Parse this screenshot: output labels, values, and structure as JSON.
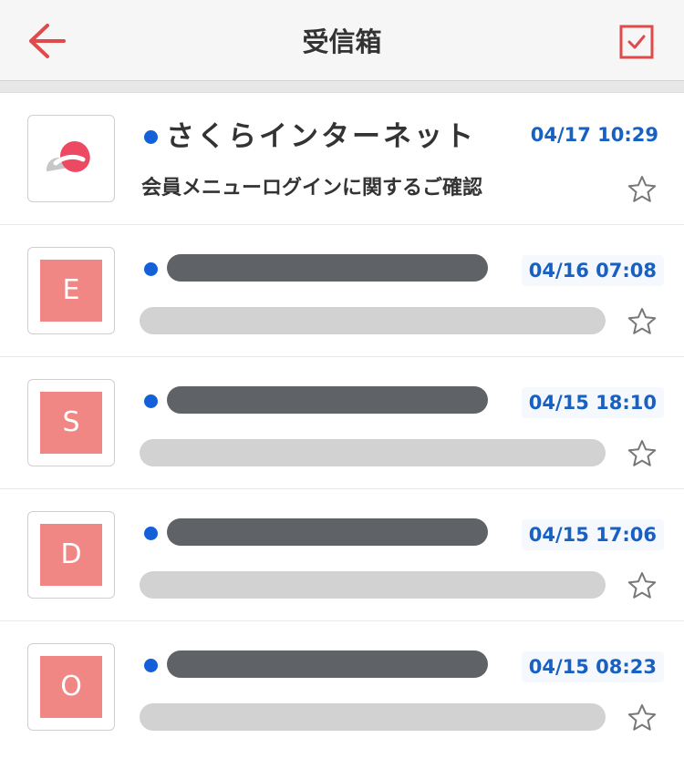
{
  "header": {
    "title": "受信箱",
    "back_icon": "arrow-left-icon",
    "select_icon": "checkbox-checked-icon"
  },
  "colors": {
    "accent": "#e04a4a",
    "unread_dot": "#1460d8",
    "date_text": "#1760c4",
    "avatar_bg": "#f08784",
    "redacted_dark": "#5f6266",
    "redacted_light": "#d2d2d2"
  },
  "emails": [
    {
      "avatar_type": "logo",
      "avatar_icon": "sakura-logo-icon",
      "unread": true,
      "sender": "さくらインターネット",
      "subject": "会員メニューログインに関するご確認",
      "date": "04/17 10:29",
      "starred": false
    },
    {
      "avatar_type": "letter",
      "avatar_letter": "E",
      "unread": true,
      "redacted": true,
      "date": "04/16 07:08",
      "starred": false
    },
    {
      "avatar_type": "letter",
      "avatar_letter": "S",
      "unread": true,
      "redacted": true,
      "date": "04/15 18:10",
      "starred": false
    },
    {
      "avatar_type": "letter",
      "avatar_letter": "D",
      "unread": true,
      "redacted": true,
      "date": "04/15 17:06",
      "starred": false
    },
    {
      "avatar_type": "letter",
      "avatar_letter": "O",
      "unread": true,
      "redacted": true,
      "date": "04/15 08:23",
      "starred": false
    }
  ]
}
